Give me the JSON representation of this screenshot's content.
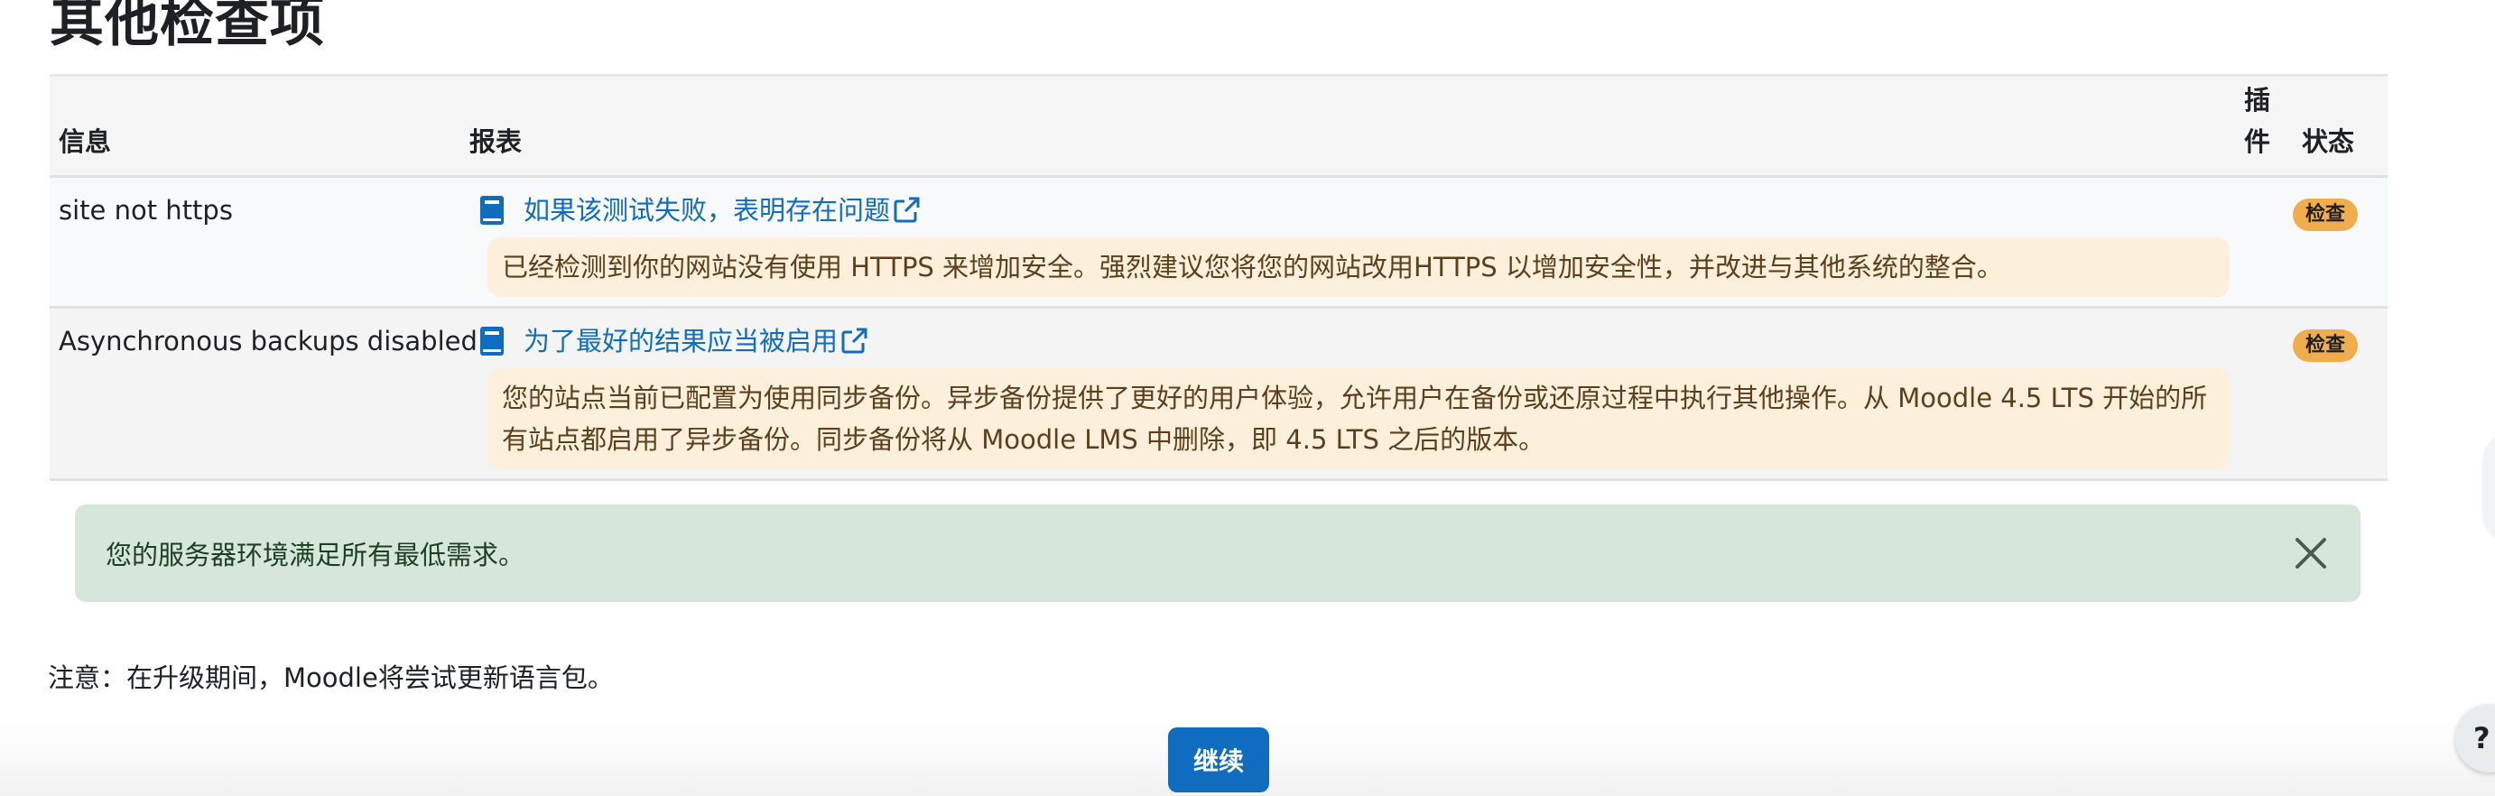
{
  "page": {
    "title": "其他检查项"
  },
  "table": {
    "headers": {
      "info": "信息",
      "report": "报表",
      "plugin": "插件",
      "status": "状态"
    },
    "rows": [
      {
        "info": "site not https",
        "link": "如果该测试失败，表明存在问题",
        "details": "已经检测到你的网站没有使用 HTTPS 来增加安全。强烈建议您将您的网站改用HTTPS 以增加安全性，并改进与其他系统的整合。",
        "status": "检查"
      },
      {
        "info": "Asynchronous backups disabled",
        "link": "为了最好的结果应当被启用",
        "details": "您的站点当前已配置为使用同步备份。异步备份提供了更好的用户体验，允许用户在备份或还原过程中执行其他操作。从 Moodle 4.5 LTS 开始的所有站点都启用了异步备份。同步备份将从 Moodle LMS 中删除，即 4.5 LTS 之后的版本。",
        "status": "检查"
      }
    ]
  },
  "success_alert": {
    "message": "您的服务器环境满足所有最低需求。"
  },
  "note": "注意：在升级期间，Moodle将尝试更新语言包。",
  "continue_button": "继续",
  "help_button": "?",
  "icons": {
    "report_link": "book-icon",
    "external": "external-link-icon",
    "dismiss": "close-icon"
  },
  "colors": {
    "link": "#0f6cbf",
    "badge_warning": "#f0ad4e",
    "alert_warning_bg": "#fcefdc",
    "alert_success_bg": "#d7e6da",
    "primary_button": "#0f6cbf"
  }
}
